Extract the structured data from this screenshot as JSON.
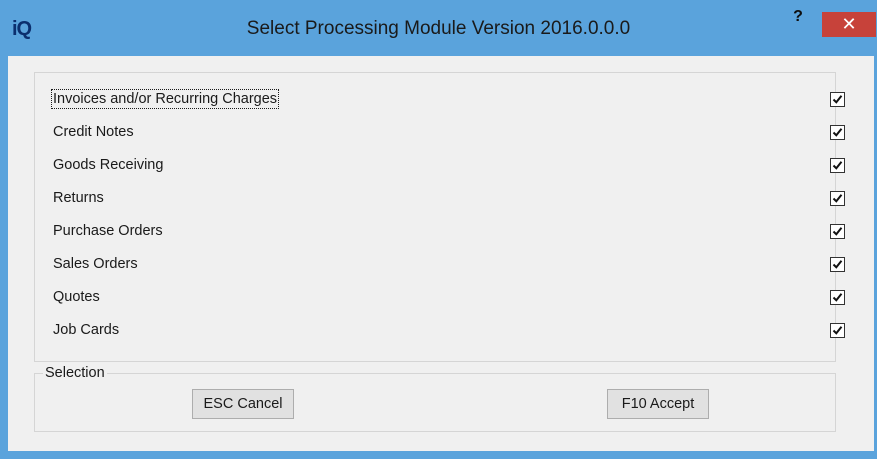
{
  "window": {
    "logo": "iQ",
    "title": "Select Processing Module Version 2016.0.0.0",
    "help_label": "?",
    "close_label": "✕"
  },
  "modules": [
    {
      "label": "Invoices and/or Recurring Charges",
      "checked": true
    },
    {
      "label": "Credit Notes",
      "checked": true
    },
    {
      "label": "Goods Receiving",
      "checked": true
    },
    {
      "label": "Returns",
      "checked": true
    },
    {
      "label": "Purchase Orders",
      "checked": true
    },
    {
      "label": "Sales Orders",
      "checked": true
    },
    {
      "label": "Quotes",
      "checked": true
    },
    {
      "label": "Job Cards",
      "checked": true
    }
  ],
  "selection": {
    "legend": "Selection",
    "cancel_label": "ESC Cancel",
    "accept_label": "F10 Accept"
  },
  "colors": {
    "titlebar": "#5aa3dc",
    "close_button": "#c7423a",
    "client_background": "#f0f0f0"
  }
}
